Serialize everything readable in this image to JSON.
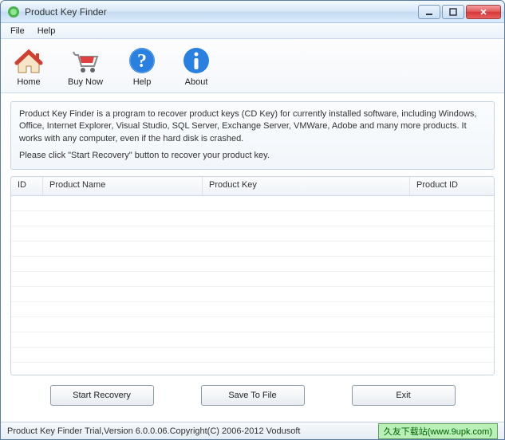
{
  "window": {
    "title": "Product Key Finder"
  },
  "menu": {
    "file": "File",
    "help": "Help"
  },
  "toolbar": {
    "home": "Home",
    "buynow": "Buy Now",
    "help": "Help",
    "about": "About"
  },
  "info": {
    "line1": "Product Key Finder is a program to recover product keys (CD Key) for currently installed software, including Windows, Office, Internet Explorer, Visual Studio, SQL Server, Exchange Server, VMWare, Adobe and many more products. It works with any computer, even if the hard disk is crashed.",
    "line2": "Please click \"Start Recovery\" button to recover your product key."
  },
  "table": {
    "headers": {
      "id": "ID",
      "name": "Product Name",
      "key": "Product Key",
      "pid": "Product ID"
    }
  },
  "buttons": {
    "start": "Start Recovery",
    "save": "Save To File",
    "exit": "Exit"
  },
  "status": "Product Key Finder Trial,Version 6.0.0.06.Copyright(C) 2006-2012 Vodusoft",
  "watermark": "久友下载站(www.9upk.com)"
}
